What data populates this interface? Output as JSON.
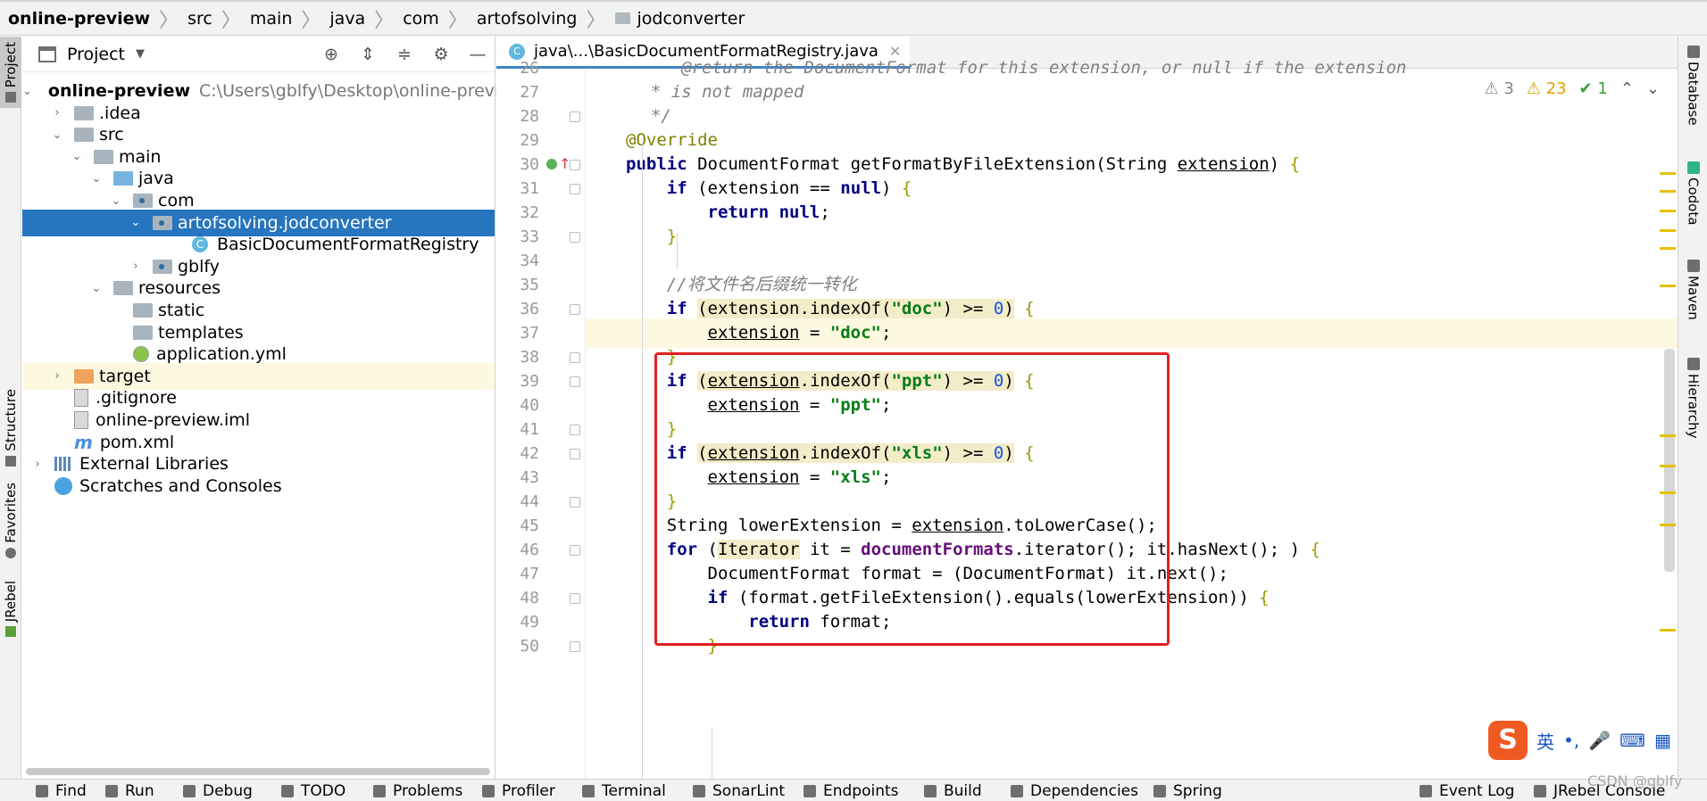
{
  "breadcrumb": [
    "online-preview",
    "src",
    "main",
    "java",
    "com",
    "artofsolving",
    "jodconverter"
  ],
  "left_tools": [
    "Project",
    "Structure",
    "Favorites",
    "JRebel"
  ],
  "right_tools": [
    "Database",
    "Codota",
    "Maven",
    "Hierarchy"
  ],
  "project": {
    "title": "Project",
    "tree": [
      {
        "label": "online-preview",
        "extra": "C:\\Users\\gblfy\\Desktop\\online-previe",
        "icon": "module-icon",
        "arrow": "down",
        "level": 0
      },
      {
        "label": ".idea",
        "icon": "folder-icon",
        "arrow": "right",
        "level": 1
      },
      {
        "label": "src",
        "icon": "folder-icon",
        "arrow": "down",
        "level": 1
      },
      {
        "label": "main",
        "icon": "folder-icon",
        "arrow": "down",
        "level": 2
      },
      {
        "label": "java",
        "icon": "source-folder-icon",
        "arrow": "down",
        "level": 3
      },
      {
        "label": "com",
        "icon": "package-icon",
        "arrow": "down",
        "level": 4
      },
      {
        "label": "artofsolving.jodconverter",
        "icon": "package-icon",
        "arrow": "down",
        "level": 5,
        "selected": true
      },
      {
        "label": "BasicDocumentFormatRegistry",
        "icon": "java-class-icon",
        "arrow": "",
        "level": 7
      },
      {
        "label": "gblfy",
        "icon": "package-icon",
        "arrow": "right",
        "level": 5
      },
      {
        "label": "resources",
        "icon": "resources-folder-icon",
        "arrow": "down",
        "level": 3
      },
      {
        "label": "static",
        "icon": "folder-icon",
        "arrow": "",
        "level": 4
      },
      {
        "label": "templates",
        "icon": "folder-icon",
        "arrow": "",
        "level": 4
      },
      {
        "label": "application.yml",
        "icon": "yaml-file-icon",
        "arrow": "",
        "level": 4
      },
      {
        "label": "target",
        "icon": "excluded-folder-icon",
        "arrow": "right",
        "level": 1,
        "highlight": true
      },
      {
        "label": ".gitignore",
        "icon": "gitignore-file-icon",
        "arrow": "",
        "level": 1
      },
      {
        "label": "online-preview.iml",
        "icon": "iml-file-icon",
        "arrow": "",
        "level": 1
      },
      {
        "label": "pom.xml",
        "icon": "maven-icon",
        "arrow": "",
        "level": 1
      },
      {
        "label": "External Libraries",
        "icon": "libraries-icon",
        "arrow": "right",
        "level": 0
      },
      {
        "label": "Scratches and Consoles",
        "icon": "scratches-icon",
        "arrow": "",
        "level": 0
      }
    ]
  },
  "editor": {
    "tab_label": "java\\...\\BasicDocumentFormatRegistry.java",
    "tab_icon": "C",
    "inspections": {
      "weak_warnings": "3",
      "warnings": "23",
      "ok": "1"
    },
    "lines": [
      {
        "n": "26",
        "html": "     <span class=\"cm\">@return the DocumentFormat for this extension, or null if the extension</span>"
      },
      {
        "n": "27",
        "html": "  <span class=\"cm\">* is not mapped</span>"
      },
      {
        "n": "28",
        "html": "  <span class=\"cm\">*/</span>"
      },
      {
        "n": "29",
        "html": "<span class=\"an\">@Override</span>"
      },
      {
        "n": "30",
        "html": "<span class=\"k\">public</span> DocumentFormat getFormatByFileExtension(String <span class=\"u\">extension</span>) <span class=\"br\">{</span>"
      },
      {
        "n": "31",
        "html": "    <span class=\"k\">if</span> (extension == <span class=\"k\">null</span>) <span class=\"br\">{</span>"
      },
      {
        "n": "32",
        "html": "        <span class=\"k\">return null</span>;"
      },
      {
        "n": "33",
        "html": "    <span class=\"br\">}</span>"
      },
      {
        "n": "34",
        "html": ""
      },
      {
        "n": "35",
        "html": "    <span class=\"cm\">//将文件名后缀统一转化</span>"
      },
      {
        "n": "36",
        "html": "    <span class=\"k\">if</span> <span class=\"bg\">(extension.indexOf(<span class=\"s\">\"doc\"</span>) &gt;= <span class=\"n\">0</span>)</span> <span class=\"br\">{</span>"
      },
      {
        "n": "37",
        "html": "        <span class=\"u\">extension</span> = <span class=\"s\">\"doc\"</span>;"
      },
      {
        "n": "38",
        "html": "    <span class=\"br\">}</span>"
      },
      {
        "n": "39",
        "html": "    <span class=\"k\">if</span> <span class=\"bg\">(<span class=\"u\">extension</span>.indexOf(<span class=\"s\">\"ppt\"</span>) &gt;= <span class=\"n\">0</span>)</span> <span class=\"br\">{</span>"
      },
      {
        "n": "40",
        "html": "        <span class=\"u\">extension</span> = <span class=\"s\">\"ppt\"</span>;"
      },
      {
        "n": "41",
        "html": "    <span class=\"br\">}</span>"
      },
      {
        "n": "42",
        "html": "    <span class=\"k\">if</span> <span class=\"bg\">(<span class=\"u\">extension</span>.indexOf(<span class=\"s\">\"xls\"</span>) &gt;= <span class=\"n\">0</span>)</span> <span class=\"br\">{</span>"
      },
      {
        "n": "43",
        "html": "        <span class=\"u\">extension</span> = <span class=\"s\">\"xls\"</span>;"
      },
      {
        "n": "44",
        "html": "    <span class=\"br\">}</span>"
      },
      {
        "n": "45",
        "html": "    String lowerExtension = <span class=\"u\">extension</span>.toLowerCase();"
      },
      {
        "n": "46",
        "html": "    <span class=\"k\">for</span> (<span class=\"bg\">Iterator</span> it = <span class=\"f\">documentFormats</span>.iterator(); it.hasNext(); ) <span class=\"br\">{</span>"
      },
      {
        "n": "47",
        "html": "        DocumentFormat format = (DocumentFormat) it.next();"
      },
      {
        "n": "48",
        "html": "        <span class=\"k\">if</span> (format.getFileExtension().equals(lowerExtension)) <span class=\"br\">{</span>"
      },
      {
        "n": "49",
        "html": "            <span class=\"k\">return</span> format;"
      },
      {
        "n": "50",
        "html": "        <span class=\"br\">}</span>"
      }
    ]
  },
  "bottom_tools": [
    "Find",
    "Run",
    "Debug",
    "TODO",
    "Problems",
    "Profiler",
    "Terminal",
    "SonarLint",
    "Endpoints",
    "Build",
    "Dependencies",
    "Spring",
    "Event Log",
    "JRebel Console"
  ],
  "ime": {
    "logo": "S",
    "items": [
      "英",
      "•,",
      "🎤",
      "⌨",
      "▦"
    ]
  },
  "watermark": "CSDN @gblfy"
}
